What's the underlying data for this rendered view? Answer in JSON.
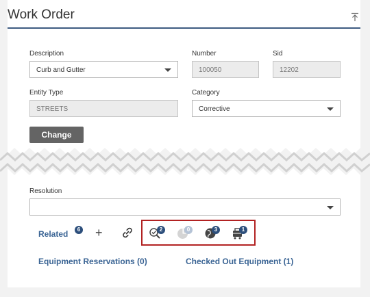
{
  "panel": {
    "title": "Work Order"
  },
  "form": {
    "description": {
      "label": "Description",
      "value": "Curb and Gutter"
    },
    "number": {
      "label": "Number",
      "value": "100050"
    },
    "sid": {
      "label": "Sid",
      "value": "12202"
    },
    "entity_type": {
      "label": "Entity Type",
      "value": "STREETS"
    },
    "category": {
      "label": "Category",
      "value": "Corrective"
    },
    "change_button": "Change",
    "resolution": {
      "label": "Resolution",
      "value": ""
    }
  },
  "related": {
    "label": "Related",
    "count": "6",
    "add_symbol": "+",
    "icons": [
      {
        "name": "inspection-search-icon",
        "count": "2",
        "enabled": true
      },
      {
        "name": "pie-chart-icon",
        "count": "0",
        "enabled": false
      },
      {
        "name": "globe-map-icon",
        "count": "3",
        "enabled": true
      },
      {
        "name": "equipment-cart-icon",
        "count": "1",
        "enabled": true
      }
    ]
  },
  "links": {
    "equipment_reservations": "Equipment Reservations (0)",
    "checked_out_equipment": "Checked Out Equipment (1)"
  },
  "colors": {
    "accent": "#3d5a80",
    "link": "#3a6494",
    "badge": "#2d4f7c",
    "highlight_box": "#b22222",
    "button": "#646464"
  }
}
